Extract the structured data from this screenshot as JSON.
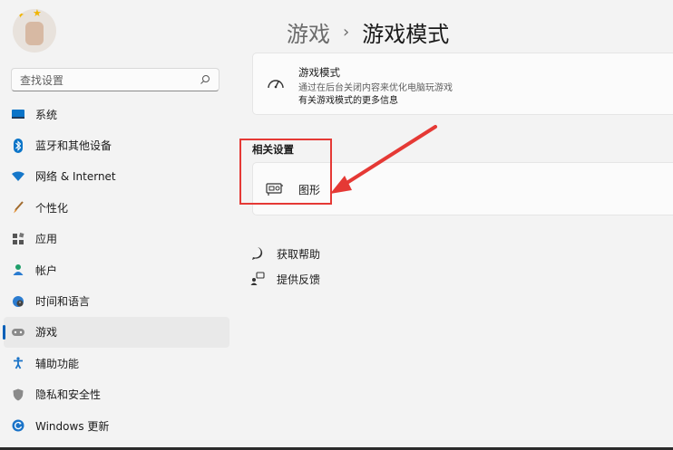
{
  "sidebar": {
    "search_placeholder": "查找设置",
    "items": [
      {
        "label": "系统",
        "icon": "monitor-icon"
      },
      {
        "label": "蓝牙和其他设备",
        "icon": "bluetooth-icon"
      },
      {
        "label": "网络 & Internet",
        "icon": "wifi-icon"
      },
      {
        "label": "个性化",
        "icon": "brush-icon"
      },
      {
        "label": "应用",
        "icon": "apps-icon"
      },
      {
        "label": "帐户",
        "icon": "account-icon"
      },
      {
        "label": "时间和语言",
        "icon": "globe-clock-icon"
      },
      {
        "label": "游戏",
        "icon": "gamepad-icon",
        "active": true
      },
      {
        "label": "辅助功能",
        "icon": "accessibility-icon"
      },
      {
        "label": "隐私和安全性",
        "icon": "shield-icon"
      },
      {
        "label": "Windows 更新",
        "icon": "update-icon"
      }
    ]
  },
  "header": {
    "breadcrumb_parent": "游戏",
    "separator": "›",
    "page_title": "游戏模式"
  },
  "game_mode_card": {
    "title": "游戏模式",
    "description": "通过在后台关闭内容来优化电脑玩游戏",
    "link": "有关游戏模式的更多信息"
  },
  "related": {
    "heading": "相关设置",
    "items": [
      {
        "label": "图形",
        "icon": "graphics-card-icon"
      }
    ]
  },
  "help_links": [
    {
      "label": "获取帮助",
      "icon": "help-icon"
    },
    {
      "label": "提供反馈",
      "icon": "feedback-icon"
    }
  ],
  "colors": {
    "accent": "#005fb8",
    "annotation": "#e53935"
  }
}
